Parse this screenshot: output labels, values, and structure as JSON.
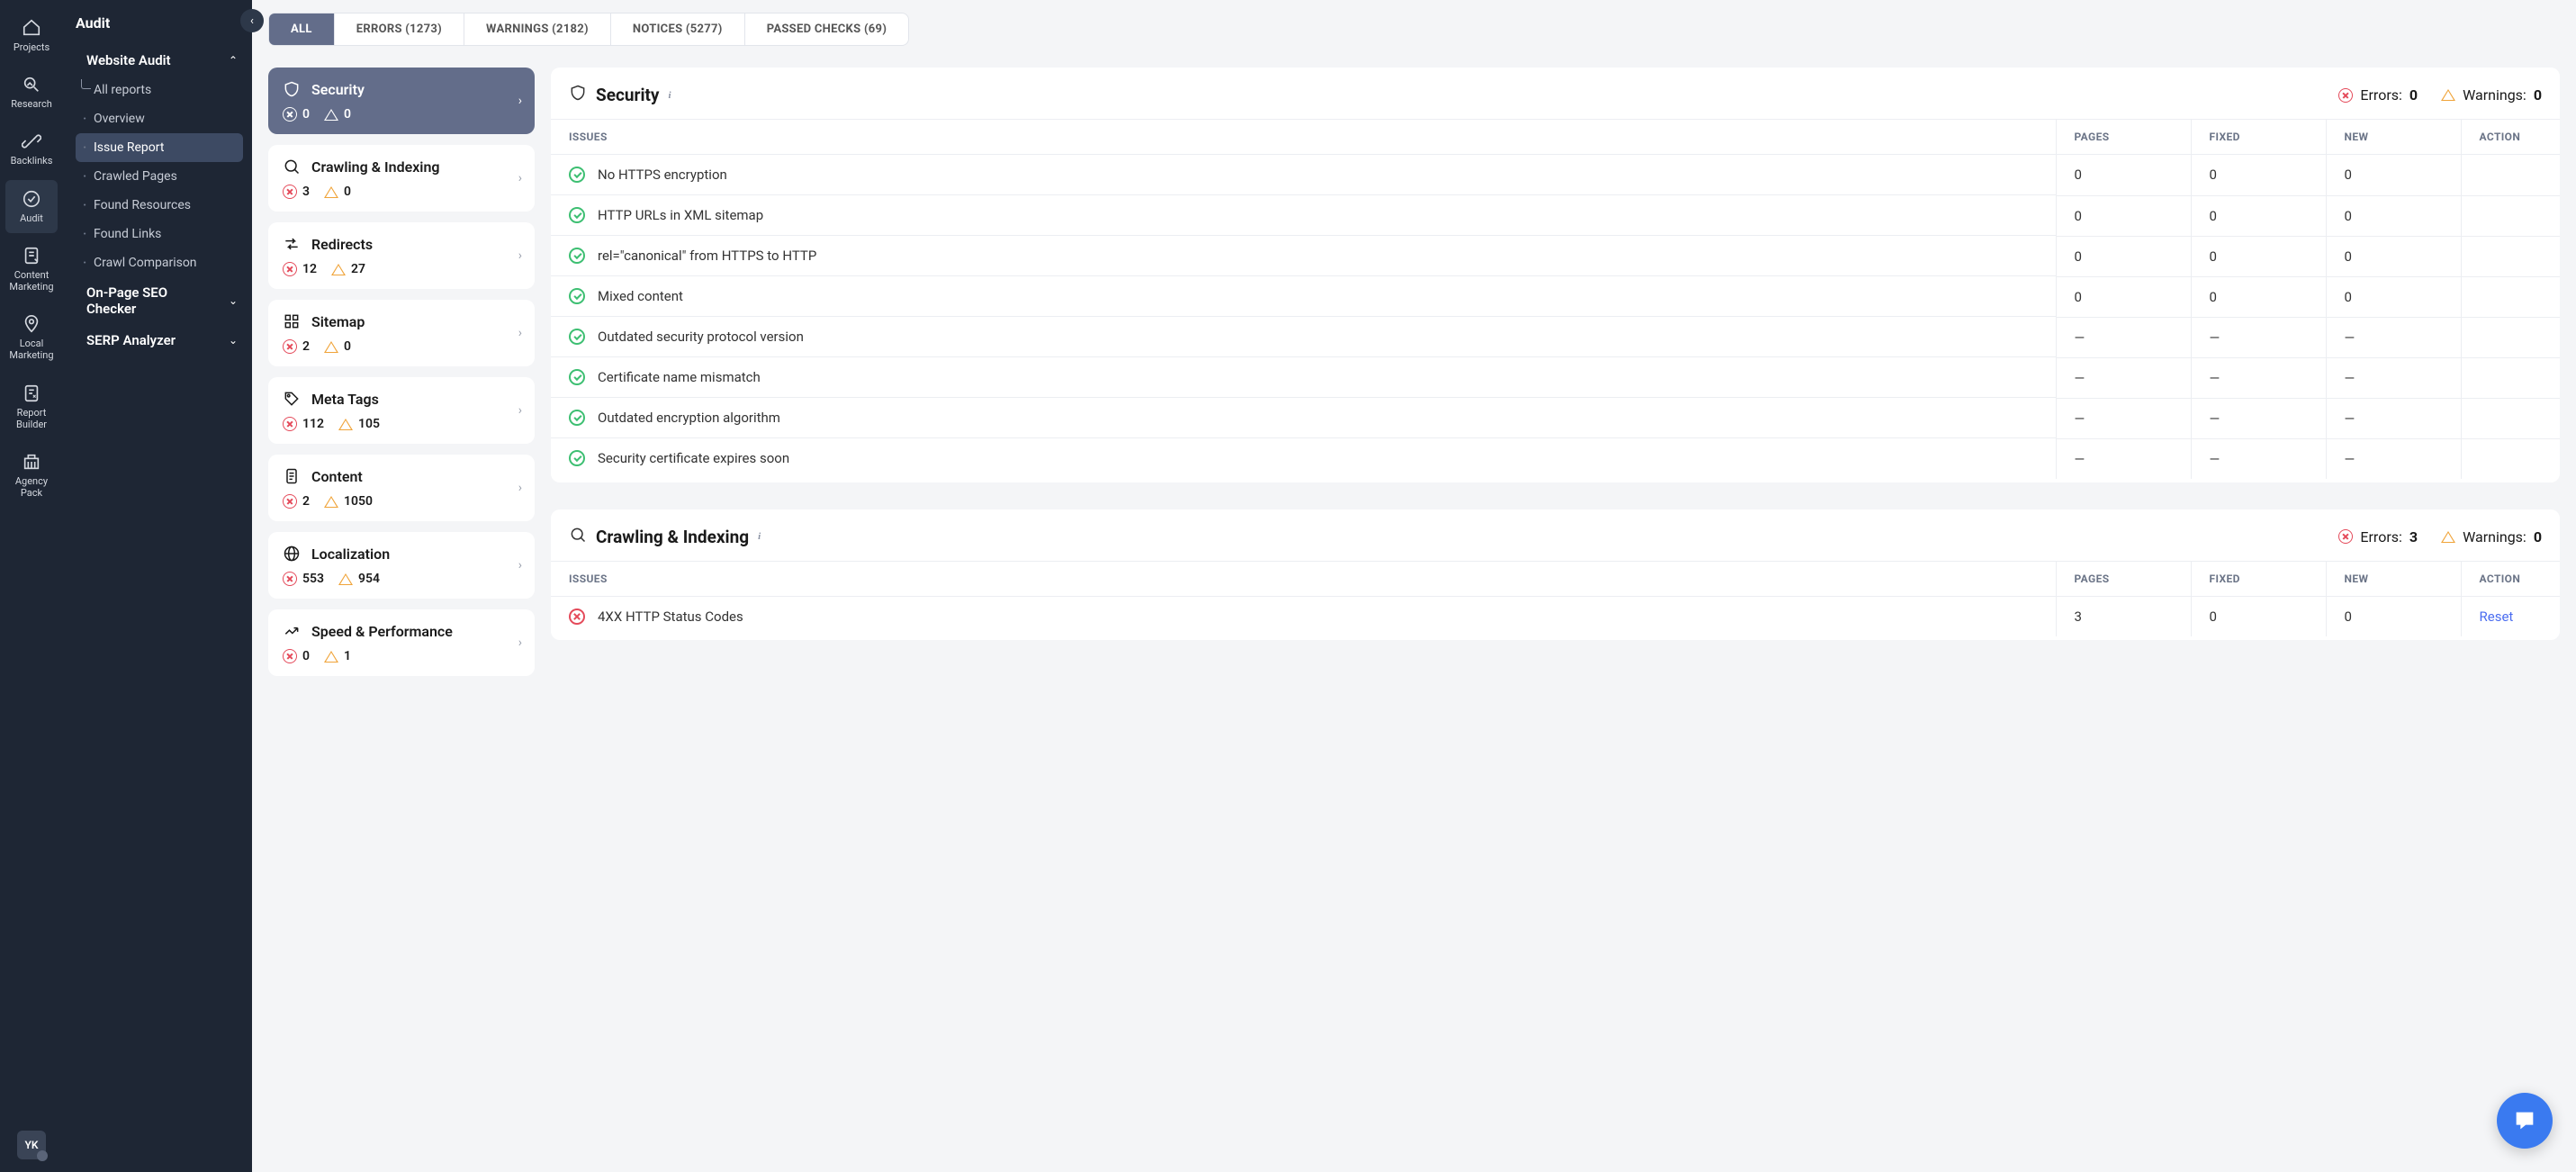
{
  "rail": [
    {
      "id": "projects",
      "label": "Projects",
      "icon": "home"
    },
    {
      "id": "research",
      "label": "Research",
      "icon": "research"
    },
    {
      "id": "backlinks",
      "label": "Backlinks",
      "icon": "backlinks"
    },
    {
      "id": "audit",
      "label": "Audit",
      "icon": "audit",
      "active": true
    },
    {
      "id": "content",
      "label": "Content Marketing",
      "icon": "content"
    },
    {
      "id": "local",
      "label": "Local Marketing",
      "icon": "local"
    },
    {
      "id": "report",
      "label": "Report Builder",
      "icon": "report"
    },
    {
      "id": "agency",
      "label": "Agency Pack",
      "icon": "agency"
    }
  ],
  "user_initials": "YK",
  "side": {
    "title": "Audit",
    "sections": [
      {
        "label": "Website Audit",
        "icon": "globe",
        "expanded": true,
        "items": [
          {
            "label": "All reports",
            "first": true
          },
          {
            "label": "Overview"
          },
          {
            "label": "Issue Report",
            "active": true
          },
          {
            "label": "Crawled Pages"
          },
          {
            "label": "Found Resources"
          },
          {
            "label": "Found Links"
          },
          {
            "label": "Crawl Comparison"
          }
        ]
      },
      {
        "label": "On-Page SEO Checker",
        "icon": "target",
        "expanded": false
      },
      {
        "label": "SERP Analyzer",
        "icon": "chart",
        "expanded": false
      }
    ]
  },
  "filters": [
    {
      "label": "ALL",
      "active": true
    },
    {
      "label": "ERRORS (1273)"
    },
    {
      "label": "WARNINGS (2182)"
    },
    {
      "label": "NOTICES (5277)"
    },
    {
      "label": "PASSED CHECKS (69)"
    }
  ],
  "categories": [
    {
      "id": "security",
      "label": "Security",
      "icon": "shield",
      "errors": 0,
      "warnings": 0,
      "selected": true
    },
    {
      "id": "crawling",
      "label": "Crawling & Indexing",
      "icon": "search",
      "errors": 3,
      "warnings": 0
    },
    {
      "id": "redirects",
      "label": "Redirects",
      "icon": "redirect",
      "errors": 12,
      "warnings": 27
    },
    {
      "id": "sitemap",
      "label": "Sitemap",
      "icon": "grid",
      "errors": 2,
      "warnings": 0
    },
    {
      "id": "meta",
      "label": "Meta Tags",
      "icon": "tag",
      "errors": 112,
      "warnings": 105
    },
    {
      "id": "content",
      "label": "Content",
      "icon": "doc",
      "errors": 2,
      "warnings": 1050
    },
    {
      "id": "local",
      "label": "Localization",
      "icon": "globe",
      "errors": 553,
      "warnings": 954
    },
    {
      "id": "speed",
      "label": "Speed & Performance",
      "icon": "trend",
      "errors": 0,
      "warnings": 1
    }
  ],
  "sections": [
    {
      "title": "Security",
      "icon": "shield",
      "errors_label": "Errors:",
      "errors": 0,
      "warnings_label": "Warnings:",
      "warnings": 0,
      "columns": [
        "ISSUES",
        "PAGES",
        "FIXED",
        "NEW",
        "ACTION"
      ],
      "rows": [
        {
          "status": "ok",
          "issue": "No HTTPS encryption",
          "pages": "0",
          "fixed": "0",
          "new": "0",
          "action": ""
        },
        {
          "status": "ok",
          "issue": "HTTP URLs in XML sitemap",
          "pages": "0",
          "fixed": "0",
          "new": "0",
          "action": ""
        },
        {
          "status": "ok",
          "issue": "rel=\"canonical\" from HTTPS to HTTP",
          "pages": "0",
          "fixed": "0",
          "new": "0",
          "action": ""
        },
        {
          "status": "ok",
          "issue": "Mixed content",
          "pages": "0",
          "fixed": "0",
          "new": "0",
          "action": ""
        },
        {
          "status": "ok",
          "issue": "Outdated security protocol version",
          "pages": "—",
          "fixed": "—",
          "new": "—",
          "action": ""
        },
        {
          "status": "ok",
          "issue": "Certificate name mismatch",
          "pages": "—",
          "fixed": "—",
          "new": "—",
          "action": ""
        },
        {
          "status": "ok",
          "issue": "Outdated encryption algorithm",
          "pages": "—",
          "fixed": "—",
          "new": "—",
          "action": ""
        },
        {
          "status": "ok",
          "issue": "Security certificate expires soon",
          "pages": "—",
          "fixed": "—",
          "new": "—",
          "action": ""
        }
      ]
    },
    {
      "title": "Crawling & Indexing",
      "icon": "search",
      "errors_label": "Errors:",
      "errors": 3,
      "warnings_label": "Warnings:",
      "warnings": 0,
      "columns": [
        "ISSUES",
        "PAGES",
        "FIXED",
        "NEW",
        "ACTION"
      ],
      "rows": [
        {
          "status": "err",
          "issue": "4XX HTTP Status Codes",
          "pages": "3",
          "fixed": "0",
          "new": "0",
          "action": "Reset"
        }
      ]
    }
  ]
}
